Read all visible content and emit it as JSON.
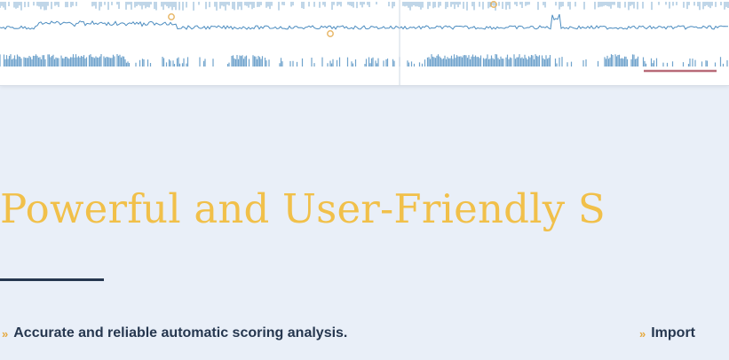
{
  "headline": "Powerful and User-Friendly S",
  "features": [
    {
      "bullet": "»",
      "text": "Accurate and reliable automatic scoring analysis."
    },
    {
      "bullet": "»",
      "text": "Import"
    }
  ],
  "colors": {
    "background": "#e9eff8",
    "headline": "#f1c04a",
    "navy": "#26374f",
    "bullet": "#e5a93f",
    "trace": "#4d8dc0",
    "marker": "#e8b86a",
    "scale_bar": "#b86a78"
  }
}
